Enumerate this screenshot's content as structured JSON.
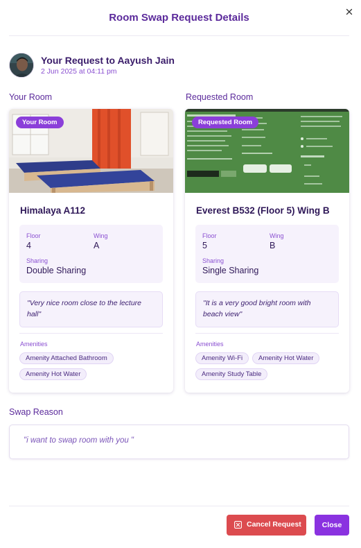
{
  "modal": {
    "title": "Room Swap Request Details",
    "close_icon": "close-icon"
  },
  "request": {
    "title": "Your Request to Aayush Jain",
    "date": "2 Jun 2025 at 04:11 pm"
  },
  "your_room": {
    "column_label": "Your Room",
    "badge": "Your Room",
    "name": "Himalaya A112",
    "floor_label": "Floor",
    "floor": "4",
    "wing_label": "Wing",
    "wing": "A",
    "sharing_label": "Sharing",
    "sharing": "Double Sharing",
    "description": "\"Very nice room close to the lecture hall\"",
    "amenities_label": "Amenities",
    "amenities": [
      "Amenity Attached Bathroom",
      "Amenity Hot Water"
    ]
  },
  "requested_room": {
    "column_label": "Requested Room",
    "badge": "Requested Room",
    "name": "Everest B532 (Floor 5) Wing B",
    "floor_label": "Floor",
    "floor": "5",
    "wing_label": "Wing",
    "wing": "B",
    "sharing_label": "Sharing",
    "sharing": "Single Sharing",
    "description": "\"It is a very good bright room with beach view\"",
    "amenities_label": "Amenities",
    "amenities": [
      "Amenity Wi-Fi",
      "Amenity Hot Water",
      "Amenity Study Table"
    ]
  },
  "swap": {
    "label": "Swap Reason",
    "reason": "\"i want to swap room with you \""
  },
  "footer": {
    "cancel_label": "Cancel Request",
    "close_label": "Close"
  },
  "colors": {
    "accent": "#8a32e0",
    "danger": "#dc4b4f",
    "title": "#5b2a9b"
  }
}
